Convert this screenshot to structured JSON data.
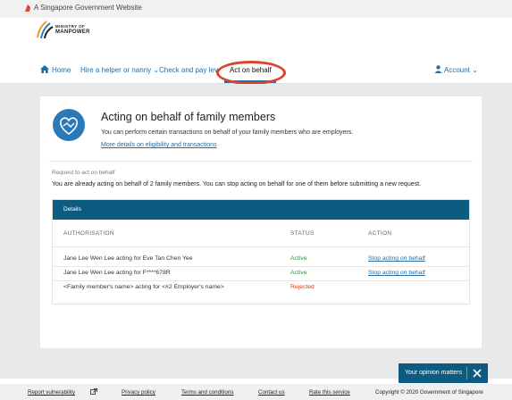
{
  "gov_bar": {
    "text": "A Singapore Government Website",
    "icon": "lion-head-icon"
  },
  "logo": {
    "line1": "MINISTRY OF",
    "line2": "MANPOWER"
  },
  "nav": {
    "home": "Home",
    "hire": "Hire a helper or nanny ⌄",
    "check": "Check and pay lev",
    "act": "Act on behalf",
    "account": "Account ⌄",
    "active_item": "Act on behalf"
  },
  "hero": {
    "icon": "heart-handshake-icon",
    "title": "Acting on behalf of family members",
    "description": "You can perform certain transactions on behalf of your family members who are employers.",
    "link": "More details on eligibility and transactions"
  },
  "request": {
    "label": "Request to act on behalf",
    "text": "You are already acting on behalf of 2 family members. You can stop acting on behalf for one of them before submitting a new request."
  },
  "table": {
    "title": "Details",
    "columns": [
      "AUTHORISATION",
      "STATUS",
      "ACTION"
    ],
    "rows": [
      {
        "authorisation": "Jane Lee Wen Lee acting for Eve Tan Chen Yee",
        "status": "Active",
        "action": "Stop acting on behalf"
      },
      {
        "authorisation": "Jane Lee Wen Lee acting for F****678R",
        "status": "Active",
        "action": "Stop acting on behalf"
      },
      {
        "authorisation": "<Family member's name> acting for <#2 Employer's name>",
        "status": "Rejected",
        "action": ""
      }
    ]
  },
  "opinion": {
    "label": "Your opinion matters",
    "close_icon": "close-icon"
  },
  "footer": {
    "links": [
      "Report vulnerability",
      "Privacy policy",
      "Terms and conditions",
      "Contact us",
      "Rate this service"
    ],
    "copyright": "Copyright © 2020 Government of Singapore"
  },
  "colors": {
    "primary": "#0e5b82",
    "link": "#1f6ea5",
    "active": "#2f8f3b",
    "rejected": "#c8431c",
    "highlight": "#d9452a"
  }
}
